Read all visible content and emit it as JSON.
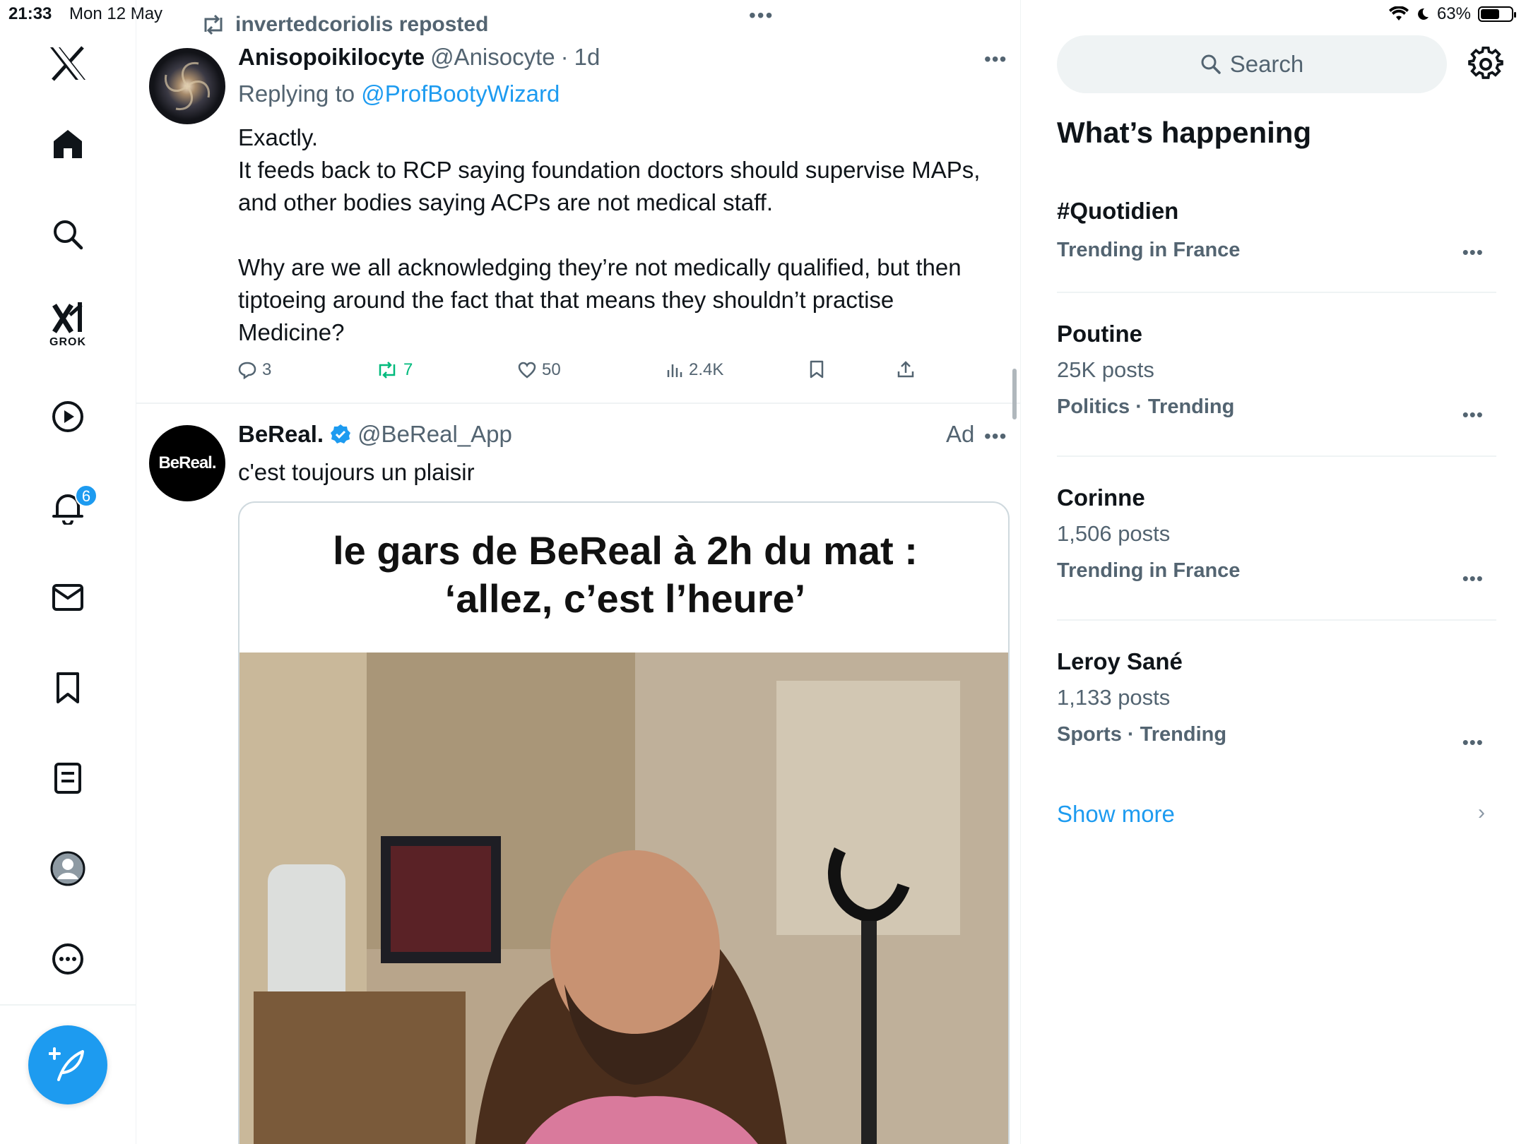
{
  "status_bar": {
    "time": "21:33",
    "date": "Mon 12 May",
    "battery": "63%",
    "battery_level": 0.63
  },
  "nav": {
    "grok_label": "GROK",
    "notifications_badge": "6"
  },
  "feed": {
    "tweet1": {
      "repost_by": "invertedcoriolis reposted",
      "name": "Anisopoikilocyte",
      "handle": "@Anisocyte",
      "sep": "·",
      "time": "1d",
      "replying_prefix": "Replying to ",
      "replying_handle": "@ProfBootyWizard",
      "text": "Exactly.\nIt feeds back to RCP saying foundation doctors should supervise MAPs, and other bodies saying ACPs are not medical staff.\n\nWhy are we all acknowledging they’re not medically qualified, but then tiptoeing around the fact that that means they shouldn’t practise Medicine?",
      "replies": "3",
      "reposts": "7",
      "likes": "50",
      "views": "2.4K"
    },
    "tweet2": {
      "avatar_text": "BeReal.",
      "name": "BeReal.",
      "handle": "@BeReal_App",
      "ad": "Ad",
      "text": "c'est toujours un plaisir",
      "meme_title": "le gars de BeReal à 2h du mat :\n‘allez, c’est l’heure’"
    }
  },
  "sidebar": {
    "search_placeholder": "Search",
    "heading": "What’s happening",
    "trends": [
      {
        "title": "#Quotidien",
        "sub": "",
        "meta": "Trending in France"
      },
      {
        "title": "Poutine",
        "sub": "25K posts",
        "meta": "Politics · Trending"
      },
      {
        "title": "Corinne",
        "sub": "1,506 posts",
        "meta": "Trending in France"
      },
      {
        "title": "Leroy Sané",
        "sub": "1,133 posts",
        "meta": "Sports · Trending"
      }
    ],
    "show_more": "Show more"
  },
  "icons": {
    "logo": "x-logo-icon",
    "home": "home-icon",
    "search": "search-icon",
    "grok": "grok-icon",
    "video": "play-icon",
    "notifications": "bell-icon",
    "messages": "mail-icon",
    "bookmarks": "bookmark-icon",
    "lists": "list-icon",
    "profile": "profile-icon",
    "more": "more-circle-icon",
    "compose": "compose-icon",
    "settings": "gear-icon"
  },
  "colors": {
    "accent": "#1d9bf0",
    "repost_green": "#00ba7c",
    "muted": "#536471"
  }
}
